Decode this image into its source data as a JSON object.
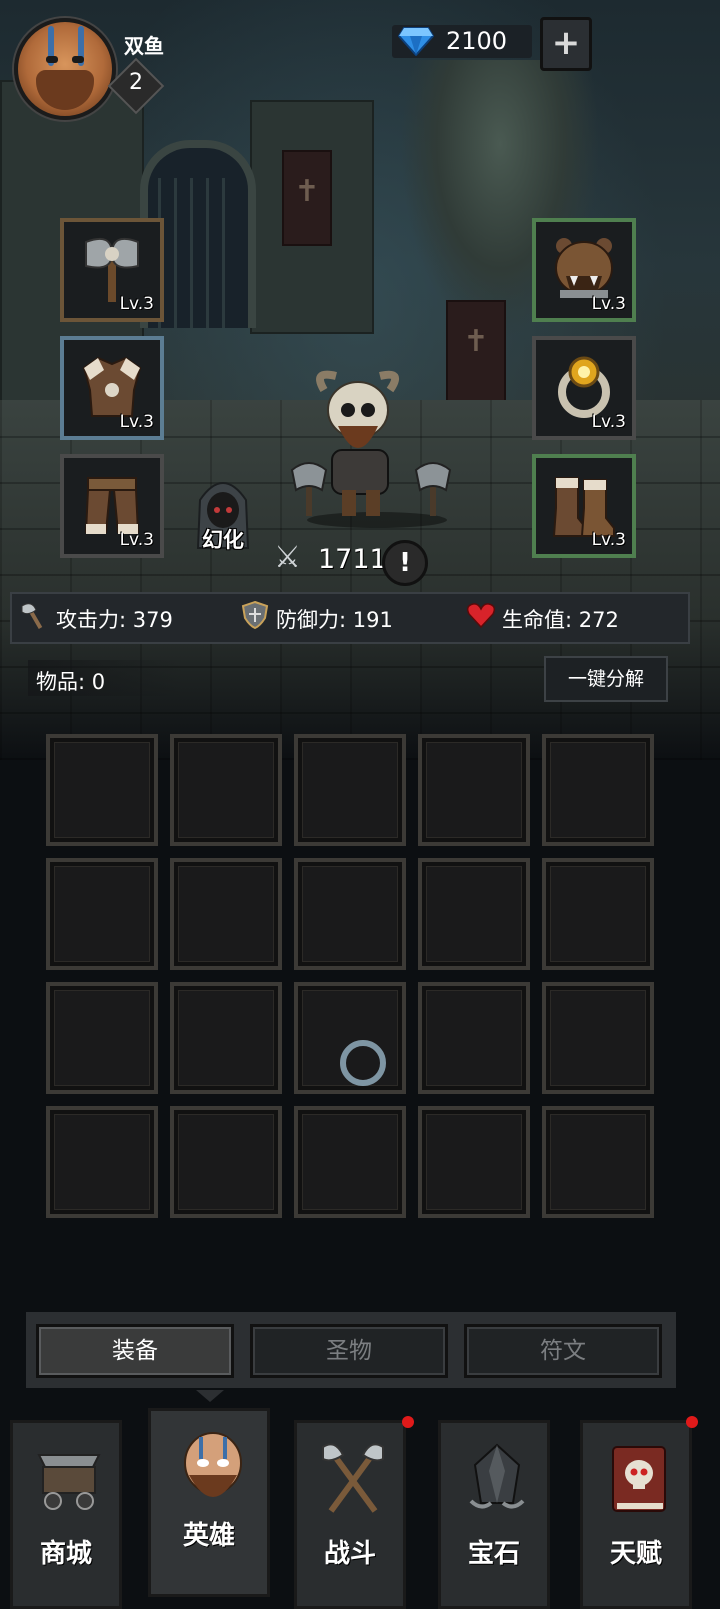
{
  "player": {
    "name": "双鱼",
    "level": "2"
  },
  "currency": {
    "gems": "2100",
    "add_label": "+"
  },
  "equipment": {
    "left": [
      {
        "name": "axe",
        "level": "Lv.3",
        "rarity": "gold"
      },
      {
        "name": "fur-armor",
        "level": "Lv.3",
        "rarity": "blue"
      },
      {
        "name": "fur-pants",
        "level": "Lv.3",
        "rarity": "gray"
      }
    ],
    "right": [
      {
        "name": "bear-helmet",
        "level": "Lv.3",
        "rarity": "green"
      },
      {
        "name": "gold-ring",
        "level": "Lv.3",
        "rarity": "gray"
      },
      {
        "name": "fur-boots",
        "level": "Lv.3",
        "rarity": "green"
      }
    ]
  },
  "hero": {
    "illusion_label": "幻化",
    "power": "1711",
    "info_label": "!"
  },
  "stats": {
    "attack": "攻击力: 379",
    "defense": "防御力: 191",
    "hp": "生命值: 272"
  },
  "inventory": {
    "items_label": "物品: 0",
    "decompose_label": "一键分解",
    "rows": 4,
    "cols": 5
  },
  "subtabs": [
    {
      "label": "装备",
      "active": true
    },
    {
      "label": "圣物",
      "active": false
    },
    {
      "label": "符文",
      "active": false
    }
  ],
  "nav": [
    {
      "label": "商城",
      "icon": "shop-cart-icon",
      "badge": false
    },
    {
      "label": "英雄",
      "icon": "hero-icon",
      "badge": false,
      "active": true
    },
    {
      "label": "战斗",
      "icon": "crossed-axes-icon",
      "badge": true
    },
    {
      "label": "宝石",
      "icon": "gem-stone-icon",
      "badge": false
    },
    {
      "label": "天赋",
      "icon": "skull-book-icon",
      "badge": true
    }
  ],
  "colors": {
    "rarity_gold": "#6c5538",
    "rarity_blue": "#5c7d93",
    "rarity_green": "#4f7f4f",
    "badge_red": "#e01a1a"
  }
}
